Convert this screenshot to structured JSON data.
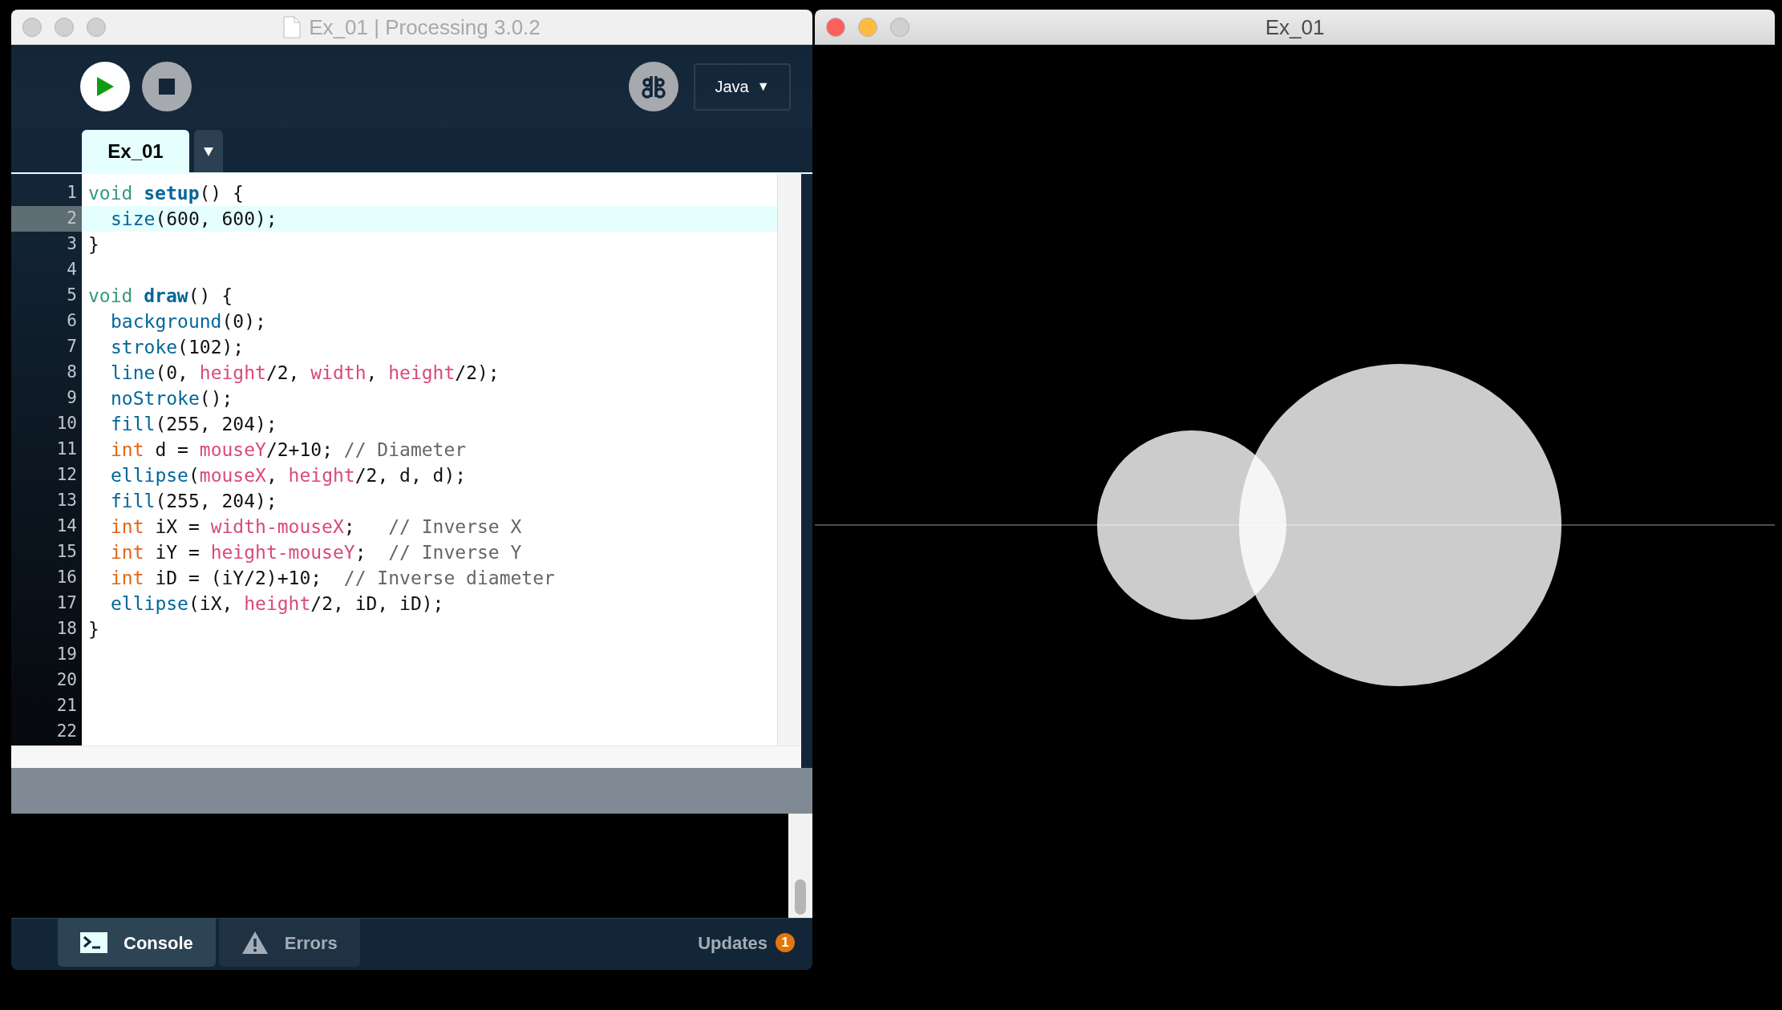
{
  "editor_window": {
    "title": "Ex_01 | Processing 3.0.2",
    "mode": "Java",
    "mode_caret": "▼",
    "tabs": [
      {
        "label": "Ex_01",
        "selected": true
      }
    ],
    "code": [
      {
        "number": "1",
        "selected": false,
        "indented": false,
        "tokens": [
          {
            "text": "void ",
            "kind": "keyword"
          },
          {
            "text": "setup",
            "kind": "defname"
          },
          {
            "text": "() {",
            "kind": "plain"
          }
        ]
      },
      {
        "number": "2",
        "selected": true,
        "indented": true,
        "tokens": [
          {
            "text": "size",
            "kind": "function"
          },
          {
            "text": "(600, 600);",
            "kind": "plain"
          }
        ]
      },
      {
        "number": "3",
        "selected": false,
        "indented": false,
        "tokens": [
          {
            "text": "}",
            "kind": "plain"
          }
        ]
      },
      {
        "number": "4",
        "selected": false,
        "indented": false
      },
      {
        "number": "5",
        "selected": false,
        "indented": false,
        "tokens": [
          {
            "text": "void ",
            "kind": "keyword"
          },
          {
            "text": "draw",
            "kind": "defname"
          },
          {
            "text": "() {",
            "kind": "plain"
          }
        ]
      },
      {
        "number": "6",
        "selected": false,
        "indented": true,
        "tokens": [
          {
            "text": "background",
            "kind": "function"
          },
          {
            "text": "(0);",
            "kind": "plain"
          }
        ]
      },
      {
        "number": "7",
        "selected": false,
        "indented": true,
        "tokens": [
          {
            "text": "stroke",
            "kind": "function"
          },
          {
            "text": "(102);",
            "kind": "plain"
          }
        ]
      },
      {
        "number": "8",
        "selected": false,
        "indented": true,
        "tokens": [
          {
            "text": "line",
            "kind": "function"
          },
          {
            "text": "(0, ",
            "kind": "plain"
          },
          {
            "text": "height",
            "kind": "variable"
          },
          {
            "text": "/2, ",
            "kind": "plain"
          },
          {
            "text": "width",
            "kind": "variable"
          },
          {
            "text": ", ",
            "kind": "plain"
          },
          {
            "text": "height",
            "kind": "variable"
          },
          {
            "text": "/2);",
            "kind": "plain"
          }
        ]
      },
      {
        "number": "9",
        "selected": false,
        "indented": true,
        "tokens": [
          {
            "text": "noStroke",
            "kind": "function"
          },
          {
            "text": "();",
            "kind": "plain"
          }
        ]
      },
      {
        "number": "10",
        "selected": false,
        "indented": true,
        "tokens": [
          {
            "text": "fill",
            "kind": "function"
          },
          {
            "text": "(255, 204);",
            "kind": "plain"
          }
        ]
      },
      {
        "number": "11",
        "selected": false,
        "indented": true,
        "tokens": [
          {
            "text": "int",
            "kind": "type"
          },
          {
            "text": " d = ",
            "kind": "plain"
          },
          {
            "text": "mouseY",
            "kind": "variable"
          },
          {
            "text": "/2+10; ",
            "kind": "plain"
          },
          {
            "text": "// Diameter",
            "kind": "comment"
          }
        ]
      },
      {
        "number": "12",
        "selected": false,
        "indented": true,
        "tokens": [
          {
            "text": "ellipse",
            "kind": "function"
          },
          {
            "text": "(",
            "kind": "plain"
          },
          {
            "text": "mouseX",
            "kind": "variable"
          },
          {
            "text": ", ",
            "kind": "plain"
          },
          {
            "text": "height",
            "kind": "variable"
          },
          {
            "text": "/2, d, d);",
            "kind": "plain"
          }
        ]
      },
      {
        "number": "13",
        "selected": false,
        "indented": true,
        "tokens": [
          {
            "text": "fill",
            "kind": "function"
          },
          {
            "text": "(255, 204);",
            "kind": "plain"
          }
        ]
      },
      {
        "number": "14",
        "selected": false,
        "indented": true,
        "tokens": [
          {
            "text": "int",
            "kind": "type"
          },
          {
            "text": " iX = ",
            "kind": "plain"
          },
          {
            "text": "width-mouseX",
            "kind": "variable"
          },
          {
            "text": ";   ",
            "kind": "plain"
          },
          {
            "text": "// Inverse X",
            "kind": "comment"
          }
        ]
      },
      {
        "number": "15",
        "selected": false,
        "indented": true,
        "tokens": [
          {
            "text": "int",
            "kind": "type"
          },
          {
            "text": " iY = ",
            "kind": "plain"
          },
          {
            "text": "height-mouseY",
            "kind": "variable"
          },
          {
            "text": ";  ",
            "kind": "plain"
          },
          {
            "text": "// Inverse Y",
            "kind": "comment"
          }
        ]
      },
      {
        "number": "16",
        "selected": false,
        "indented": true,
        "tokens": [
          {
            "text": "int",
            "kind": "type"
          },
          {
            "text": " iD = (iY/2)+10;  ",
            "kind": "plain"
          },
          {
            "text": "// Inverse diameter",
            "kind": "comment"
          }
        ]
      },
      {
        "number": "17",
        "selected": false,
        "indented": true,
        "tokens": [
          {
            "text": "ellipse",
            "kind": "function"
          },
          {
            "text": "(iX, ",
            "kind": "plain"
          },
          {
            "text": "height",
            "kind": "variable"
          },
          {
            "text": "/2, iD, iD);",
            "kind": "plain"
          }
        ]
      },
      {
        "number": "18",
        "selected": false,
        "indented": false,
        "tokens": [
          {
            "text": "}",
            "kind": "plain"
          }
        ]
      },
      {
        "number": "19",
        "selected": false,
        "indented": false
      },
      {
        "number": "20",
        "selected": false,
        "indented": false
      },
      {
        "number": "21",
        "selected": false,
        "indented": false
      },
      {
        "number": "22",
        "selected": false,
        "indented": false
      }
    ],
    "bottom_tabs": [
      {
        "label": "Console",
        "kind": "console",
        "selected": true
      },
      {
        "label": "Errors",
        "kind": "errors",
        "selected": false
      }
    ],
    "updates": {
      "label": "Updates",
      "count": "1"
    }
  },
  "sketch_window": {
    "title": "Ex_01"
  }
}
